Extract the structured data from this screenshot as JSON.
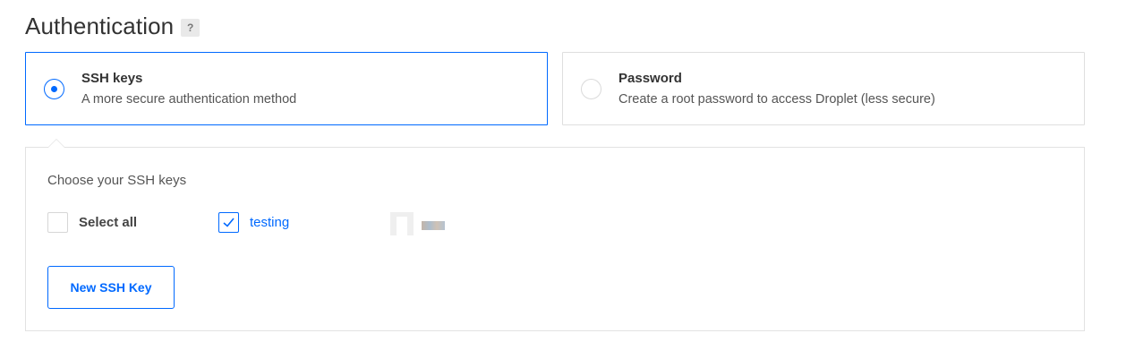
{
  "header": {
    "title": "Authentication",
    "help_label": "?"
  },
  "options": {
    "ssh": {
      "title": "SSH keys",
      "description": "A more secure authentication method",
      "selected": true
    },
    "password": {
      "title": "Password",
      "description": "Create a root password to access Droplet (less secure)",
      "selected": false
    }
  },
  "ssh_panel": {
    "heading": "Choose your SSH keys",
    "select_all_label": "Select all",
    "select_all_checked": false,
    "keys": [
      {
        "label": "testing",
        "checked": true
      }
    ],
    "new_key_button": "New SSH Key"
  },
  "colors": {
    "accent": "#0069ff",
    "border": "#dfdfdf",
    "text": "#444444"
  }
}
